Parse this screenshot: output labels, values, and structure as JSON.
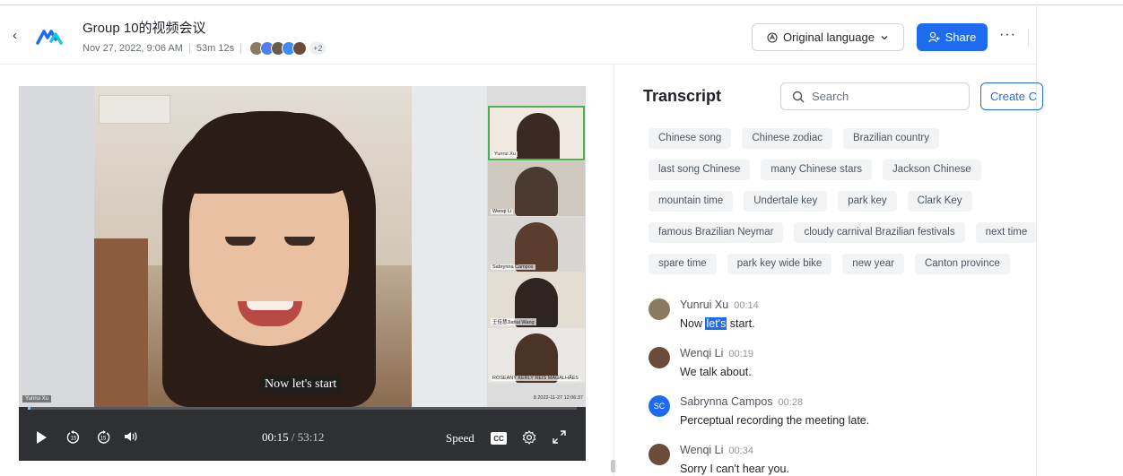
{
  "header": {
    "back_glyph": "‹",
    "title": "Group 10的视频会议",
    "date": "Nov 27, 2022, 9:06 AM",
    "duration": "53m 12s",
    "participants_more": "+2",
    "language_label": "Original language",
    "share_label": "Share",
    "more_glyph": "···"
  },
  "video": {
    "main_speaker_name": "Yunrui Xu",
    "caption": "Now let's start",
    "thumbnails": [
      {
        "name": "Yunrui Xu"
      },
      {
        "name": "Wenqi Li"
      },
      {
        "name": "Sabrynna Campos"
      },
      {
        "name": "王佳慧Jiahui Wang"
      },
      {
        "name": "ROSEANY KERLY REIS MAGALHÃES"
      }
    ],
    "thumbs_footer": "8   2022-11-27 12:06:37",
    "current_time": "00:15",
    "total_time": "/ 53:12",
    "speed_label": "Speed",
    "cc_label": "CC",
    "progress": 0.005
  },
  "transcript": {
    "title": "Transcript",
    "search_placeholder": "Search",
    "create_label": "Create C",
    "tags": [
      [
        "Chinese song",
        "Chinese zodiac",
        "Brazilian country"
      ],
      [
        "last song Chinese",
        "many Chinese stars",
        "Jackson Chinese"
      ],
      [
        "mountain time",
        "Undertale key",
        "park key",
        "Clark Key"
      ],
      [
        "famous Brazilian Neymar",
        "cloudy carnival Brazilian festivals",
        "next time"
      ],
      [
        "spare time",
        "park key wide bike",
        "new year",
        "Canton province"
      ]
    ],
    "messages": [
      {
        "speaker": "Yunrui Xu",
        "time": "00:14",
        "text_before": "Now ",
        "highlight": "let's",
        "text_after": " start."
      },
      {
        "speaker": "Wenqi Li",
        "time": "00:19",
        "text_before": "We talk about.",
        "highlight": "",
        "text_after": ""
      },
      {
        "speaker": "Sabrynna Campos",
        "time": "00:28",
        "initials": "SC",
        "text_before": "Perceptual recording the meeting late.",
        "highlight": "",
        "text_after": ""
      },
      {
        "speaker": "Wenqi Li",
        "time": "00:34",
        "text_before": "Sorry I can't hear you.",
        "highlight": "",
        "text_after": ""
      }
    ]
  },
  "colors": {
    "accent": "#1f6bf0",
    "control_bar": "#2f3033",
    "tag_bg": "#f2f3f5"
  }
}
